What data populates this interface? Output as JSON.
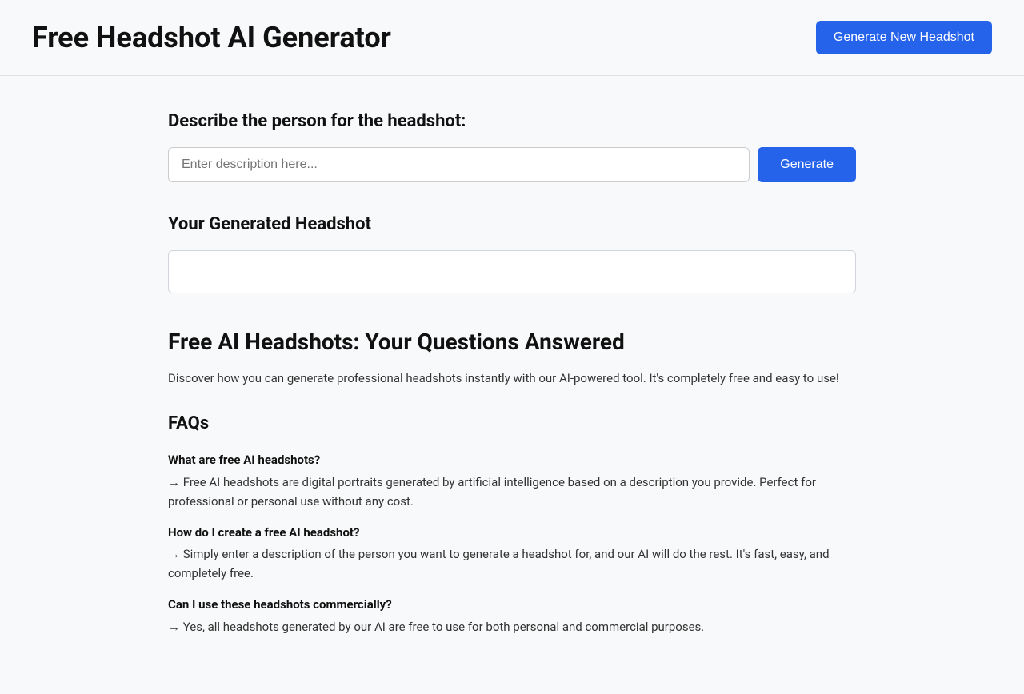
{
  "header": {
    "title": "Free Headshot AI Generator",
    "generate_new_label": "Generate New Headshot"
  },
  "form": {
    "section_label": "Describe the person for the headshot:",
    "input_placeholder": "Enter description here...",
    "generate_label": "Generate"
  },
  "headshot_section": {
    "heading": "Your Generated Headshot"
  },
  "faq_section": {
    "main_heading": "Free AI Headshots: Your Questions Answered",
    "description": "Discover how you can generate professional headshots instantly with our AI-powered tool. It's completely free and easy to use!",
    "faqs_heading": "FAQs",
    "items": [
      {
        "question": "What are free AI headshots?",
        "answer": "→  Free AI headshots are digital portraits generated by artificial intelligence based on a description you provide. Perfect for professional or personal use without any cost."
      },
      {
        "question": "How do I create a free AI headshot?",
        "answer": "→  Simply enter a description of the person you want to generate a headshot for, and our AI will do the rest. It's fast, easy, and completely free."
      },
      {
        "question": "Can I use these headshots commercially?",
        "answer": "→  Yes, all headshots generated by our AI are free to use for both personal and commercial purposes."
      }
    ]
  }
}
